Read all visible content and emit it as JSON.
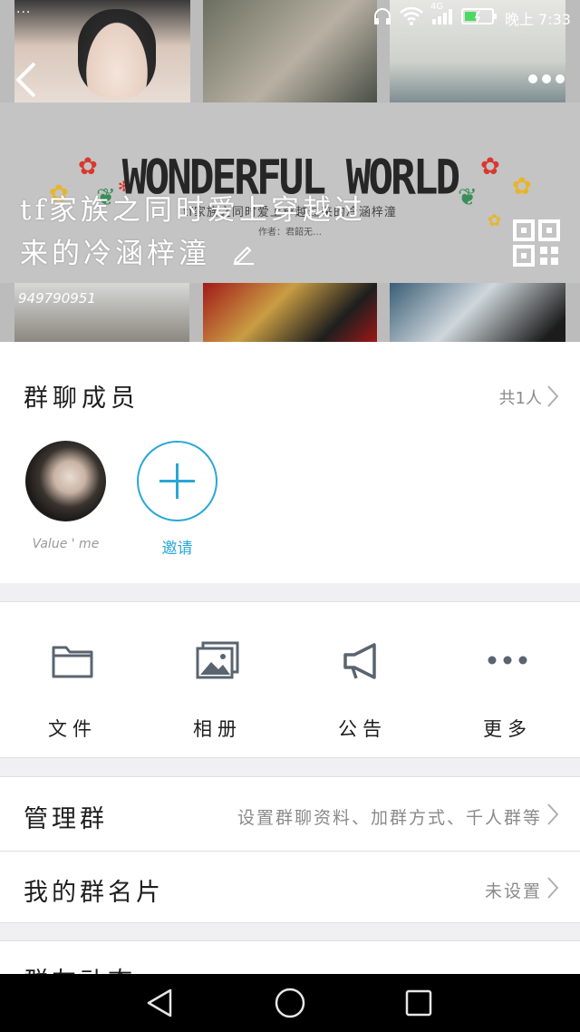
{
  "status_bar": {
    "left_dots": "···",
    "network": "4G",
    "time": "晚上 7:33"
  },
  "cover": {
    "banner_title": "WONDERFUL WORLD",
    "banner_subtitle": "tf家族之同时爱上穿越过来的冷涵梓潼",
    "banner_author": "作者：君韶无…",
    "group_name_line1": "tf家族之同时爱上穿越过",
    "group_name_line2": "来的冷涵梓潼",
    "group_id": "949790951"
  },
  "members": {
    "title": "群聊成员",
    "count": "共1人",
    "member_name": "Value ' me",
    "invite_label": "邀请"
  },
  "actions": [
    {
      "label": "文件",
      "icon": "folder-icon"
    },
    {
      "label": "相册",
      "icon": "photo-album-icon"
    },
    {
      "label": "公告",
      "icon": "megaphone-icon"
    },
    {
      "label": "更多",
      "icon": "more-dots-icon"
    }
  ],
  "manage": {
    "title": "管理群",
    "value": "设置群聊资料、加群方式、千人群等"
  },
  "card": {
    "title": "我的群名片",
    "value": "未设置"
  },
  "tail": {
    "title": "群友动态"
  },
  "colors": {
    "accent": "#2aa7d6",
    "secondary_text": "#8a8a8a",
    "icon_gray": "#5a6470"
  }
}
